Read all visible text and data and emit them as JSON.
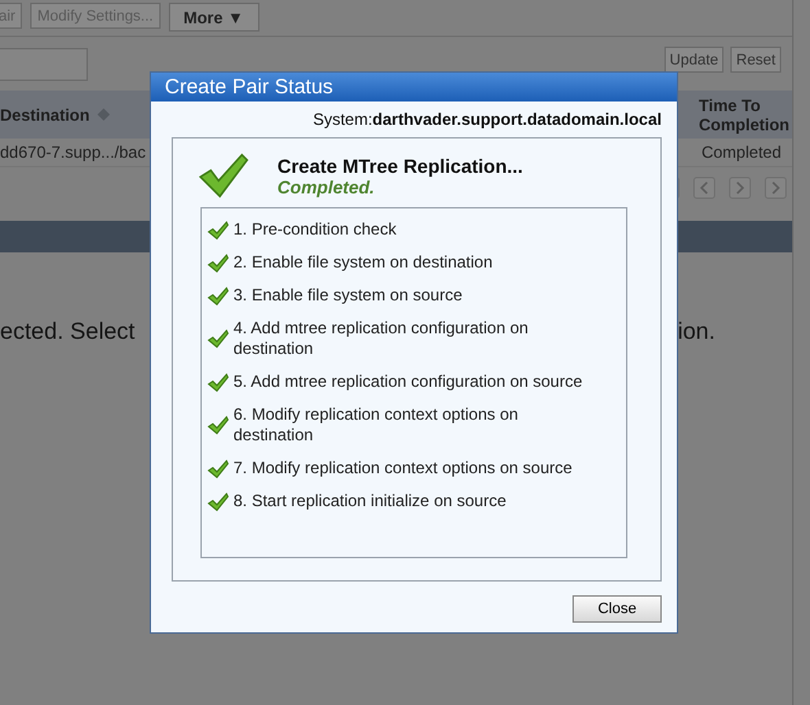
{
  "toolbar": {
    "buttons": [
      {
        "label": "air",
        "kind": "plain"
      },
      {
        "label": "Modify Settings...",
        "kind": "plain"
      },
      {
        "label": "More ▼",
        "kind": "menu"
      }
    ]
  },
  "filter": {
    "buttons": [
      "Update",
      "Reset"
    ]
  },
  "table": {
    "columns": [
      {
        "label": "Destination",
        "sortable": true
      },
      {
        "label": "Time To Completion",
        "sortable": false
      }
    ],
    "rows": [
      [
        "dd670-7.supp.../bac",
        "Completed"
      ]
    ]
  },
  "message": {
    "left": "ected. Select",
    "right": "ion."
  },
  "dialog": {
    "title": "Create Pair Status",
    "system": "System:**darthvader.support.datadomain.local**",
    "heading": "Create MTree Replication...",
    "status": "Completed.",
    "steps": [
      {
        "label": "1. Pre-condition check"
      },
      {
        "label": "2. Enable file system on destination"
      },
      {
        "label": "3. Enable file system on source"
      },
      {
        "label": "4. Add mtree replication configuration on destination"
      },
      {
        "label": "5. Add mtree replication configuration on source"
      },
      {
        "label": "6. Modify replication context options on destination"
      },
      {
        "label": "7. Modify replication context options on source"
      },
      {
        "label": "8. Start replication initialize on source"
      }
    ],
    "button": "Close"
  }
}
